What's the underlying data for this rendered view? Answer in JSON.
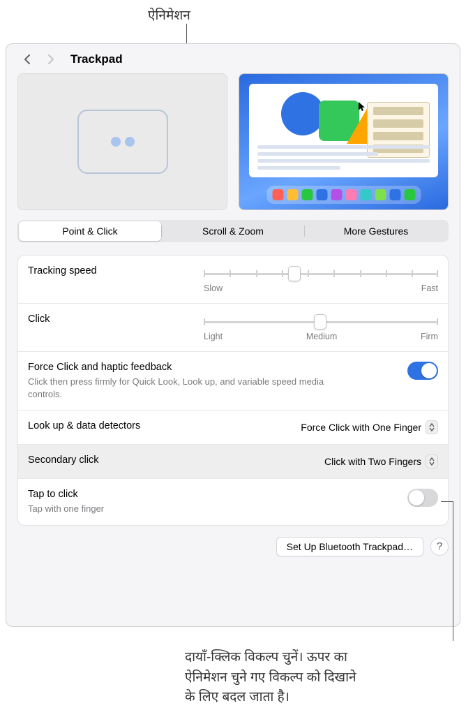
{
  "callouts": {
    "top": "ऐनिमेशन",
    "bottom_line1": "दायाँ-क्लिक विकल्प चुनें। ऊपर का",
    "bottom_line2": "ऐनिमेशन चुने गए विकल्प को दिखाने",
    "bottom_line3": "के लिए बदल जाता है।"
  },
  "nav": {
    "title": "Trackpad"
  },
  "tabs": {
    "point_click": "Point & Click",
    "scroll_zoom": "Scroll & Zoom",
    "more_gestures": "More Gestures"
  },
  "settings": {
    "tracking_speed": {
      "label": "Tracking speed",
      "min": "Slow",
      "max": "Fast"
    },
    "click": {
      "label": "Click",
      "min": "Light",
      "mid": "Medium",
      "max": "Firm"
    },
    "force_click": {
      "label": "Force Click and haptic feedback",
      "desc": "Click then press firmly for Quick Look, Look up, and variable speed media controls."
    },
    "lookup": {
      "label": "Look up & data detectors",
      "value": "Force Click with One Finger"
    },
    "secondary": {
      "label": "Secondary click",
      "value": "Click with Two Fingers"
    },
    "tap": {
      "label": "Tap to click",
      "desc": "Tap with one finger"
    }
  },
  "buttons": {
    "setup_bt": "Set Up Bluetooth Trackpad…",
    "help": "?"
  },
  "dock_colors": [
    "#ff6058",
    "#ffbc34",
    "#29c740",
    "#2f72e4",
    "#b450e5",
    "#ff7bb3",
    "#34c8c8",
    "#7fe04d",
    "#2f72e4",
    "#29c740"
  ]
}
